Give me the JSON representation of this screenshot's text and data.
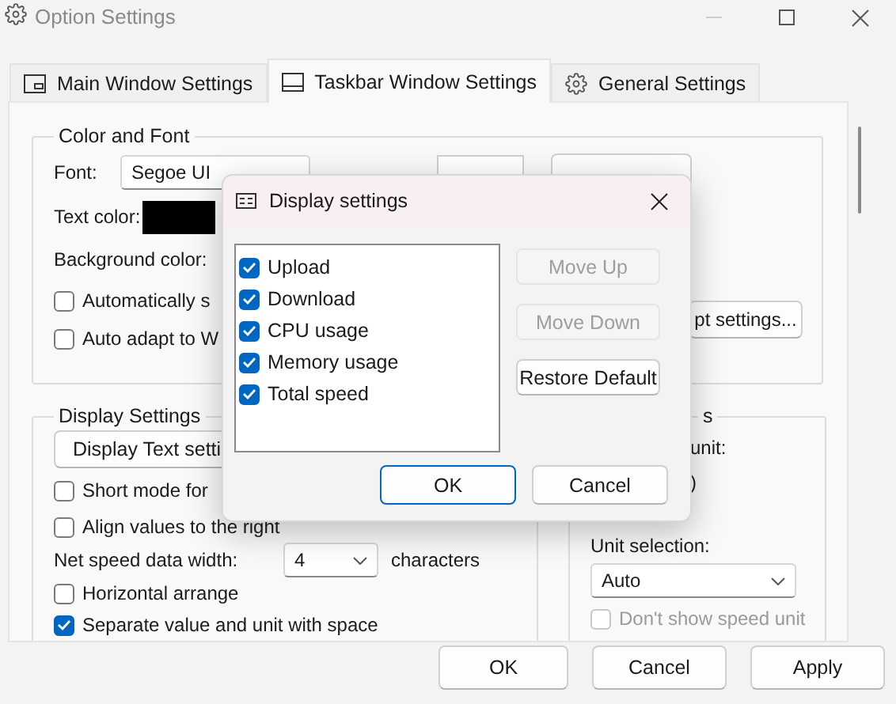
{
  "window": {
    "title": "Option Settings"
  },
  "tabs": [
    {
      "label": "Main Window Settings",
      "selected": false,
      "kind": "window"
    },
    {
      "label": "Taskbar Window Settings",
      "selected": true,
      "kind": "taskbar"
    },
    {
      "label": "General Settings",
      "selected": false,
      "kind": "gear"
    }
  ],
  "color_and_font": {
    "title": "Color and Font",
    "font_label": "Font:",
    "font_value": "Segoe UI",
    "text_color_label": "Text color:",
    "background_color_label": "Background color:",
    "checkboxes": [
      {
        "label": "Automatically s",
        "checked": false
      },
      {
        "label": "Auto adapt to W",
        "checked": false
      }
    ],
    "script_button": "pt settings..."
  },
  "display_settings": {
    "title": "Display Settings",
    "text_settings_button": "Display Text setti",
    "items": [
      {
        "kind": "checkbox",
        "label": "Short mode for",
        "checked": false
      },
      {
        "kind": "checkbox",
        "label": "Align values to the right",
        "checked": false
      },
      {
        "kind": "width",
        "label": "Net speed data width:",
        "value": "4",
        "suffix": "characters"
      },
      {
        "kind": "checkbox",
        "label": "Horizontal arrange",
        "checked": false
      },
      {
        "kind": "checkbox",
        "label": "Separate value and unit with space",
        "checked": true
      }
    ]
  },
  "speed_units": {
    "title": "s",
    "lines": [
      "unit:",
      ")"
    ],
    "unit_selection_label": "Unit selection:",
    "unit_selection_value": "Auto",
    "hide_unit": {
      "label": "Don't show speed unit",
      "checked": false,
      "disabled": true
    }
  },
  "dialog": {
    "title": "Display settings",
    "items": [
      {
        "label": "Upload",
        "checked": true
      },
      {
        "label": "Download",
        "checked": true
      },
      {
        "label": "CPU usage",
        "checked": true
      },
      {
        "label": "Memory usage",
        "checked": true
      },
      {
        "label": "Total speed",
        "checked": true
      }
    ],
    "side_buttons": [
      {
        "label": "Move Up",
        "disabled": true
      },
      {
        "label": "Move Down",
        "disabled": true
      },
      {
        "label": "Restore Default",
        "disabled": false
      }
    ],
    "buttons": [
      {
        "label": "OK",
        "primary": true
      },
      {
        "label": "Cancel",
        "primary": false
      }
    ]
  },
  "buttons": [
    "OK",
    "Cancel",
    "Apply"
  ]
}
